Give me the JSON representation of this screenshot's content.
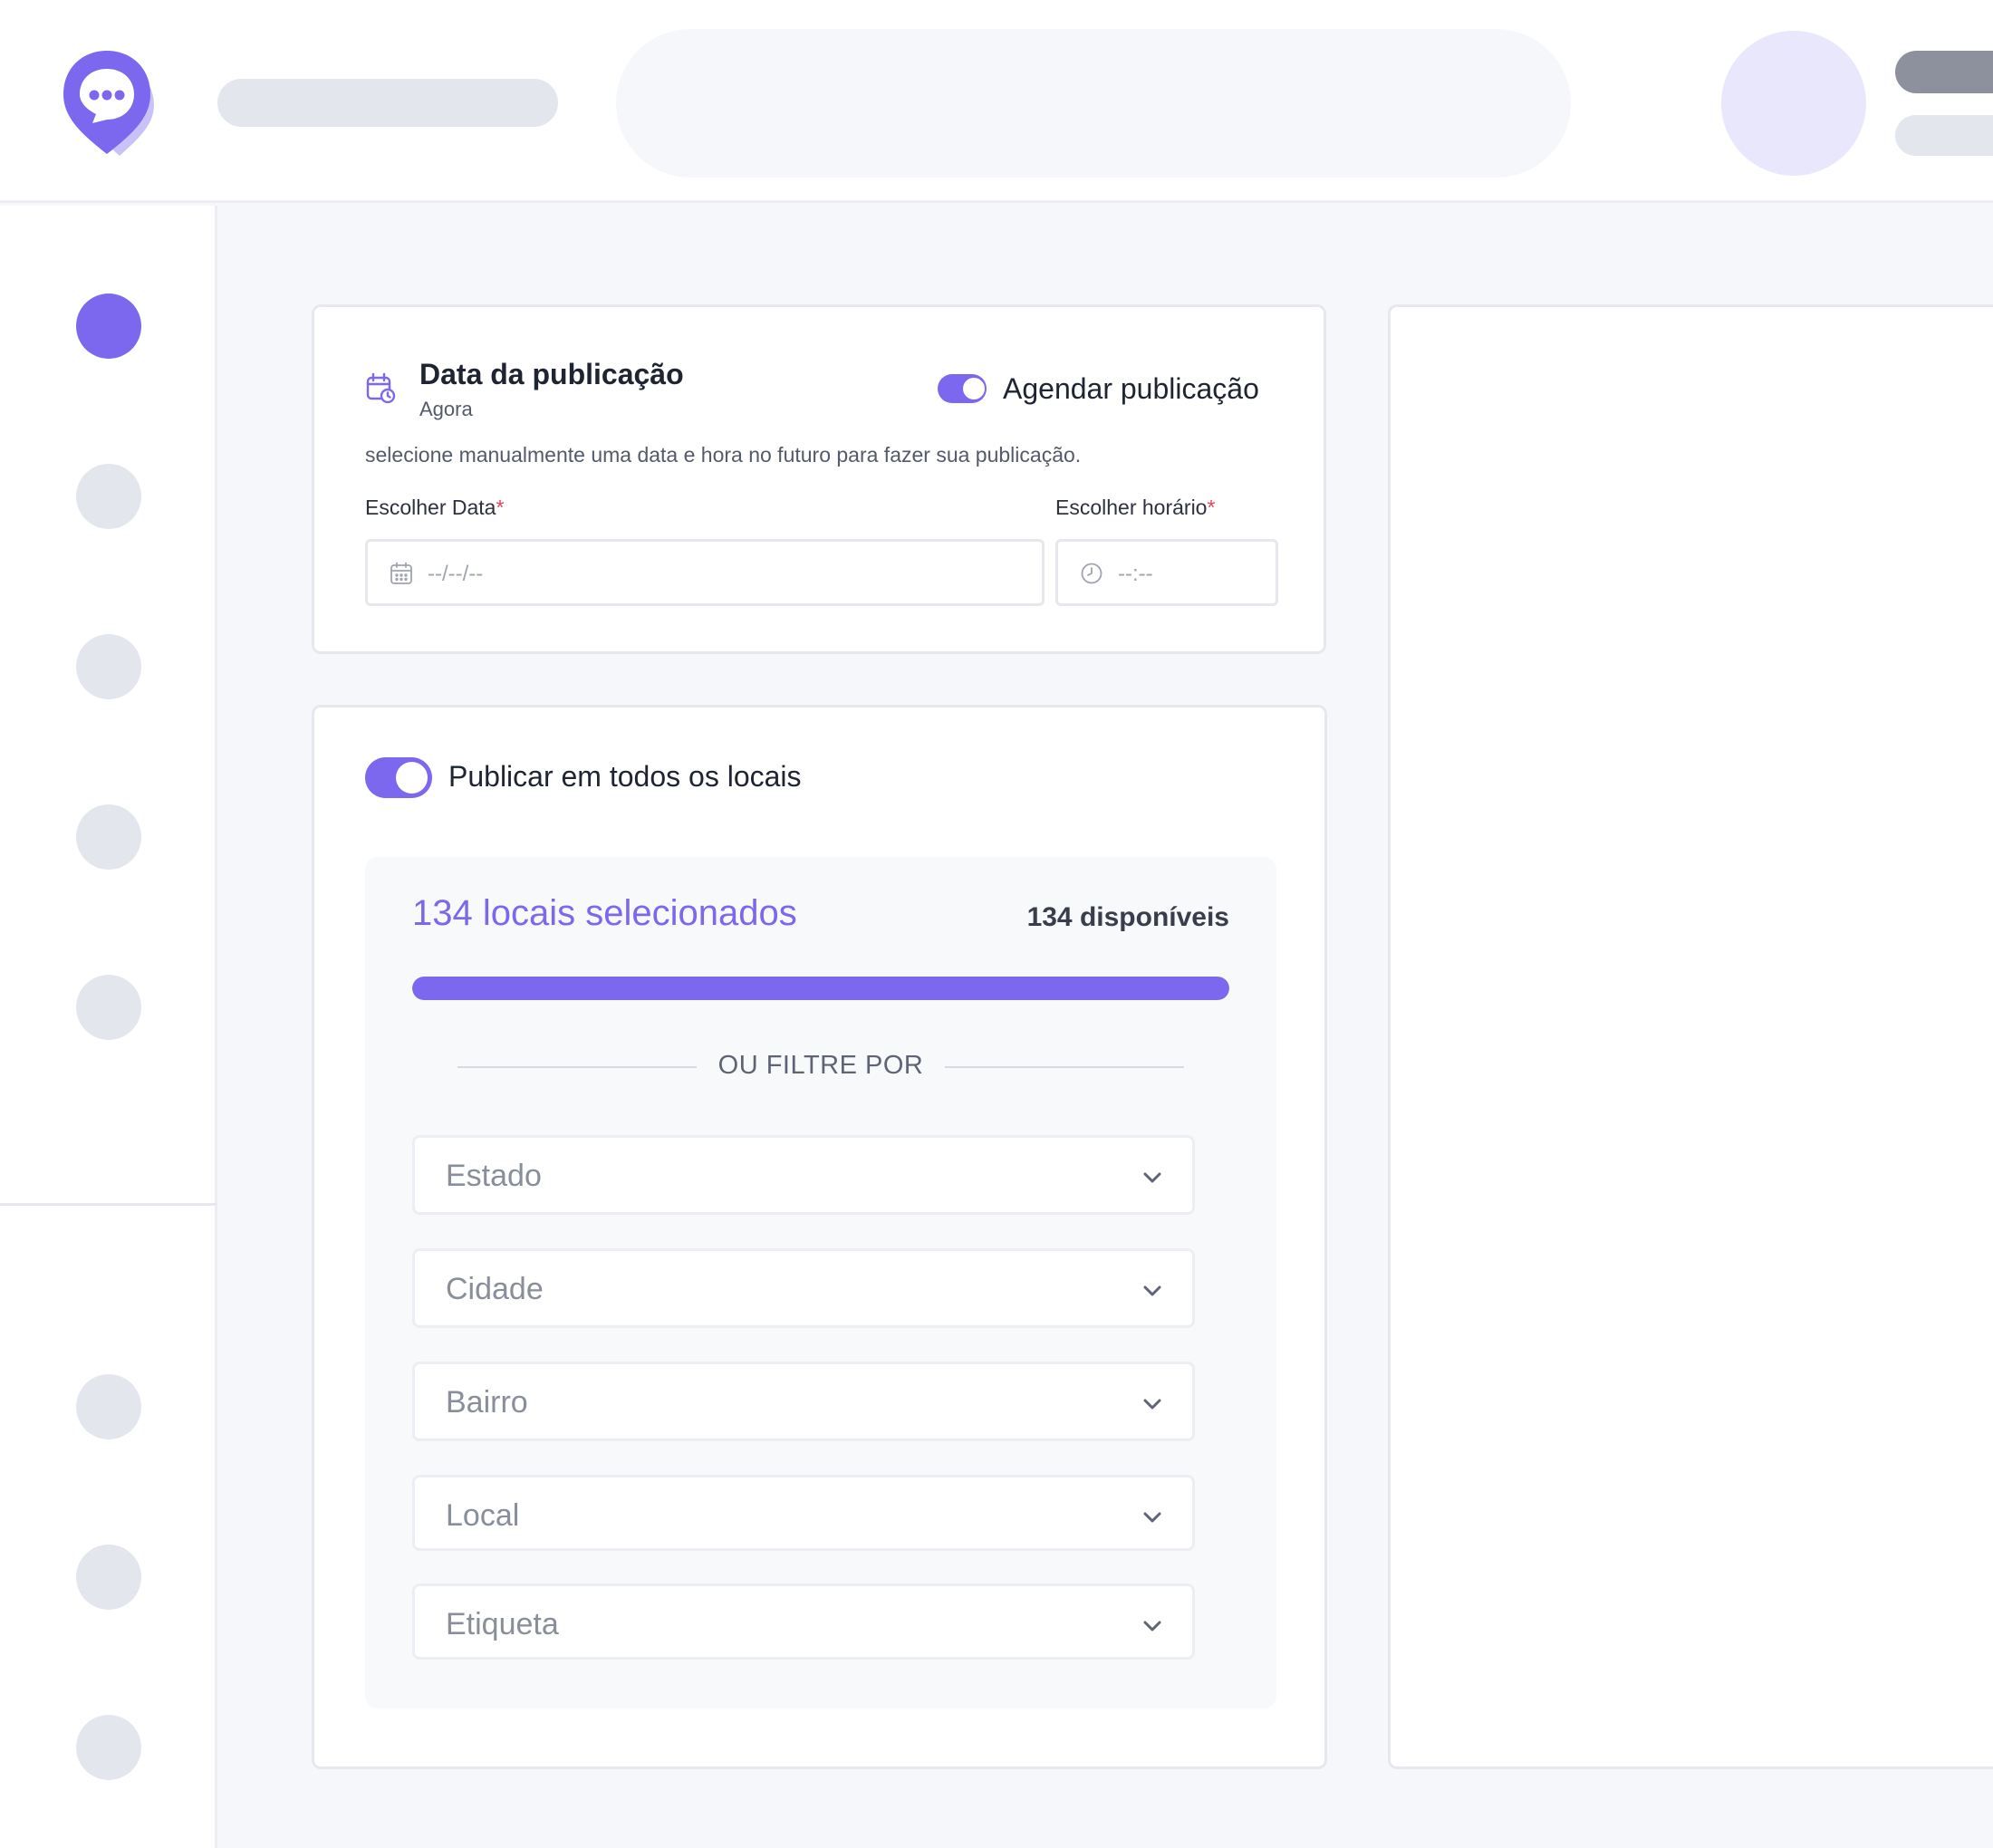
{
  "brand": {
    "accent": "#7b68ee",
    "logo_icon": "chat-pin-icon"
  },
  "publication_date": {
    "title": "Data da publicação",
    "subtitle": "Agora",
    "schedule_toggle_label": "Agendar publicação",
    "schedule_enabled": true,
    "help_text": "selecione manualmente uma data e hora no futuro para fazer sua publicação.",
    "date_label": "Escolher Data",
    "date_placeholder": "--/--/--",
    "time_label": "Escolher horário",
    "time_placeholder": "--:--",
    "required_mark": "*"
  },
  "locations": {
    "publish_all_label": "Publicar em todos os locais",
    "publish_all_enabled": true,
    "selected_text": "134 locais selecionados",
    "available_text": "134 disponíveis",
    "selected_fraction": 1.0,
    "or_filter_label": "OU FILTRE POR",
    "filters": [
      {
        "label": "Estado"
      },
      {
        "label": "Cidade"
      },
      {
        "label": "Bairro"
      },
      {
        "label": "Local"
      },
      {
        "label": "Etiqueta"
      }
    ]
  }
}
